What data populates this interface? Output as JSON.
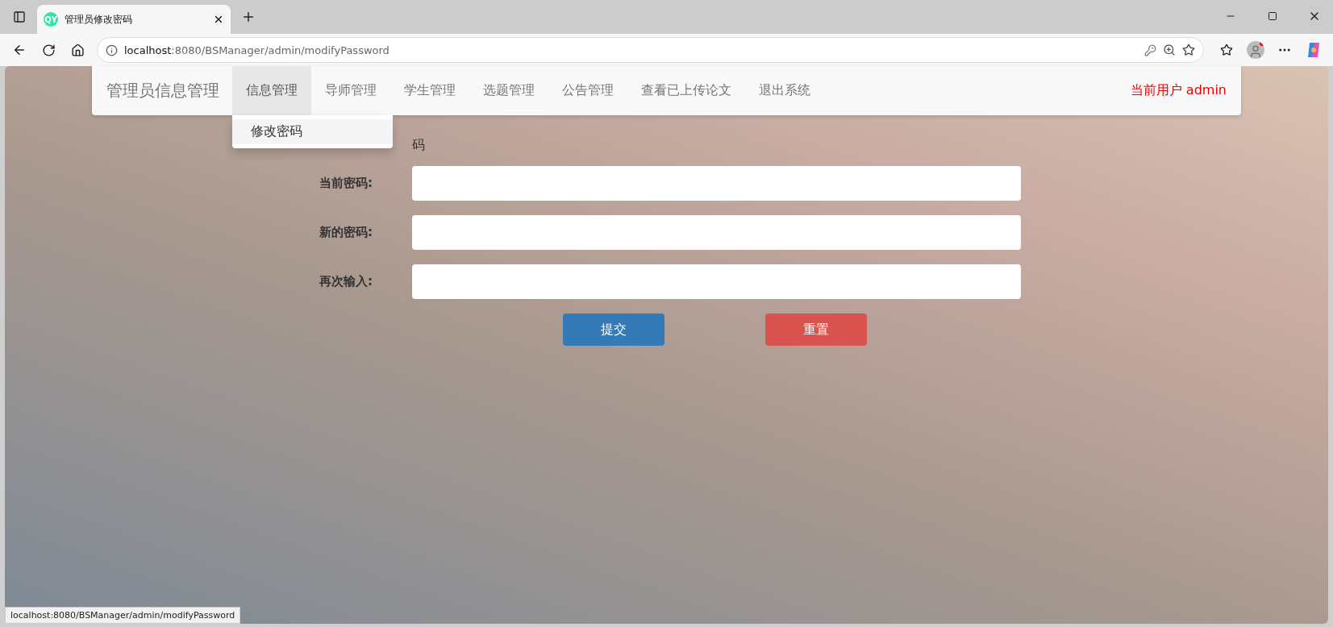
{
  "browser": {
    "tab": {
      "favicon": "QY",
      "title": "管理员修改密码"
    },
    "address": {
      "host": "localhost",
      "path": ":8080/BSManager/admin/modifyPassword"
    }
  },
  "navbar": {
    "brand": "管理员信息管理",
    "items": [
      {
        "label": "信息管理",
        "selected": true,
        "menu": [
          "修改密码"
        ]
      },
      {
        "label": "导师管理",
        "selected": false
      },
      {
        "label": "学生管理",
        "selected": false
      },
      {
        "label": "选题管理",
        "selected": false
      },
      {
        "label": "公告管理",
        "selected": false
      },
      {
        "label": "查看已上传论文",
        "selected": false
      },
      {
        "label": "退出系统",
        "selected": false
      }
    ],
    "current_user": "当前用户 admin"
  },
  "form": {
    "heading": "码",
    "fields": [
      {
        "label": "当前密码:"
      },
      {
        "label": "新的密码:"
      },
      {
        "label": "再次输入:"
      }
    ],
    "buttons": [
      {
        "label": "提交",
        "kind": "primary"
      },
      {
        "label": "重置",
        "kind": "danger"
      }
    ]
  },
  "status_bar": "localhost:8080/BSManager/admin/modifyPassword"
}
